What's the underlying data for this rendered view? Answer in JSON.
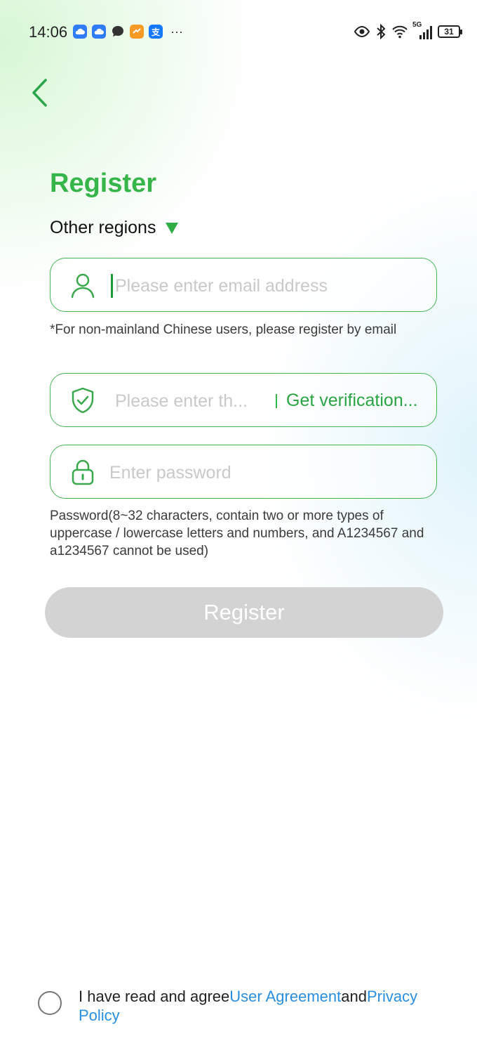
{
  "status_bar": {
    "time": "14:06",
    "notif_icons": [
      {
        "name": "cloud-app-icon",
        "color": "#2f7cf6",
        "glyph": "☁"
      },
      {
        "name": "cloud-app-icon-2",
        "color": "#2f7cf6",
        "glyph": "☁"
      },
      {
        "name": "chat-bubble-icon",
        "color": "#333333",
        "glyph": ""
      },
      {
        "name": "orange-app-icon",
        "color": "#f59a24",
        "glyph": "✓"
      },
      {
        "name": "alipay-icon",
        "color": "#1677ff",
        "glyph": "支"
      }
    ],
    "more": "···",
    "network": "5G",
    "battery": "31"
  },
  "page": {
    "title": "Register",
    "region_label": "Other regions"
  },
  "form": {
    "email_placeholder": "Please enter email address",
    "email_hint": "*For non-mainland Chinese users, please register by email",
    "code_placeholder": "Please enter th...",
    "get_code_label": "Get verification...",
    "password_placeholder": "Enter password",
    "password_hint": "Password(8~32 characters, contain two or more types of uppercase / lowercase letters and numbers, and A1234567 and a1234567 cannot be used)",
    "register_label": "Register"
  },
  "agreement": {
    "prefix": "I have read and agree",
    "user_agreement": "User Agreement",
    "and": "and",
    "privacy_policy": "Privacy Policy"
  },
  "colors": {
    "accent": "#35b54a",
    "link": "#2a8ee0",
    "button_disabled": "#d3d3d3"
  }
}
